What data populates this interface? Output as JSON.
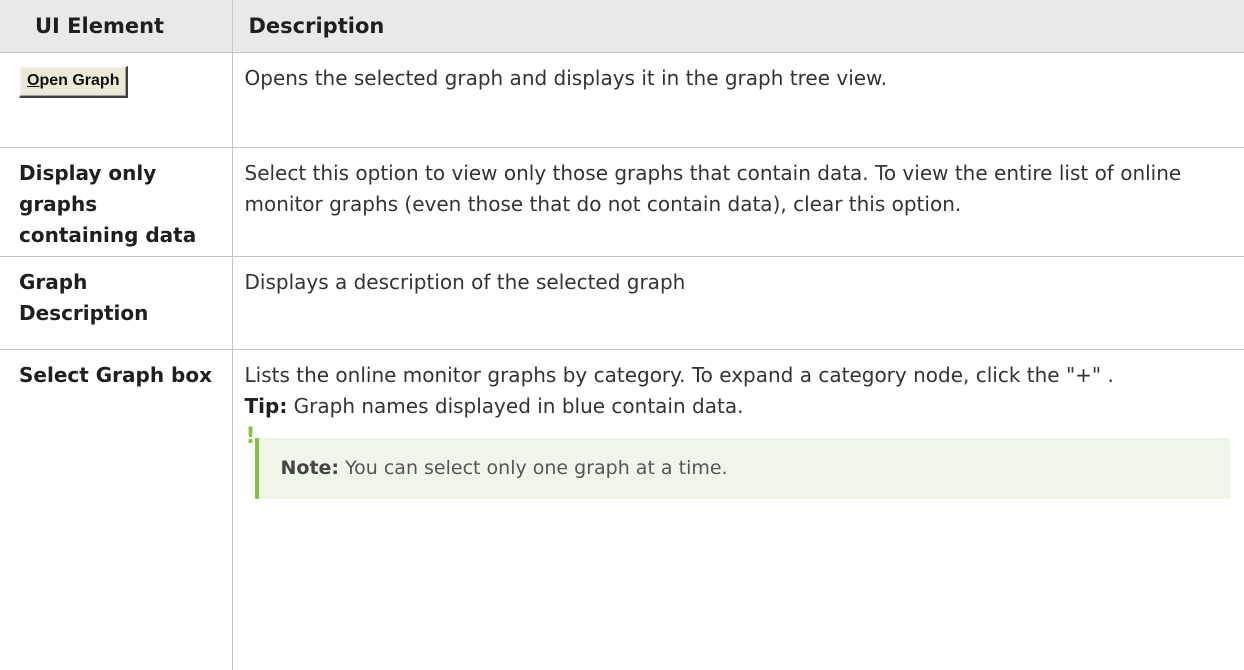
{
  "table": {
    "headers": {
      "element": "UI Element",
      "description": "Description"
    },
    "rows": [
      {
        "element": "Open Graph",
        "element_mnemonic": "O",
        "element_rest": "pen Graph",
        "description": "Opens the selected graph and displays it in the graph tree view."
      },
      {
        "element": "Display only graphs containing data",
        "description": "Select this option to view only those graphs that contain data. To view the entire list of online monitor graphs (even those that do not contain data), clear this option."
      },
      {
        "element": "Graph Description",
        "description": "Displays a description of the selected graph"
      },
      {
        "element": "Select Graph box",
        "description": "Lists the online monitor graphs by category. To expand a category node, click the \"+\" .",
        "tip_label": "Tip:",
        "tip_text": " Graph names displayed in blue contain data.",
        "note_label": "Note:",
        "note_text": " You can select only one graph at a time.",
        "note_icon": "exclamation-icon"
      }
    ]
  },
  "colors": {
    "header_bg": "#e9e9e9",
    "border": "#c6c6c6",
    "note_bg": "#eff5e8",
    "note_accent": "#82c341",
    "button_face": "#ece9d8"
  }
}
